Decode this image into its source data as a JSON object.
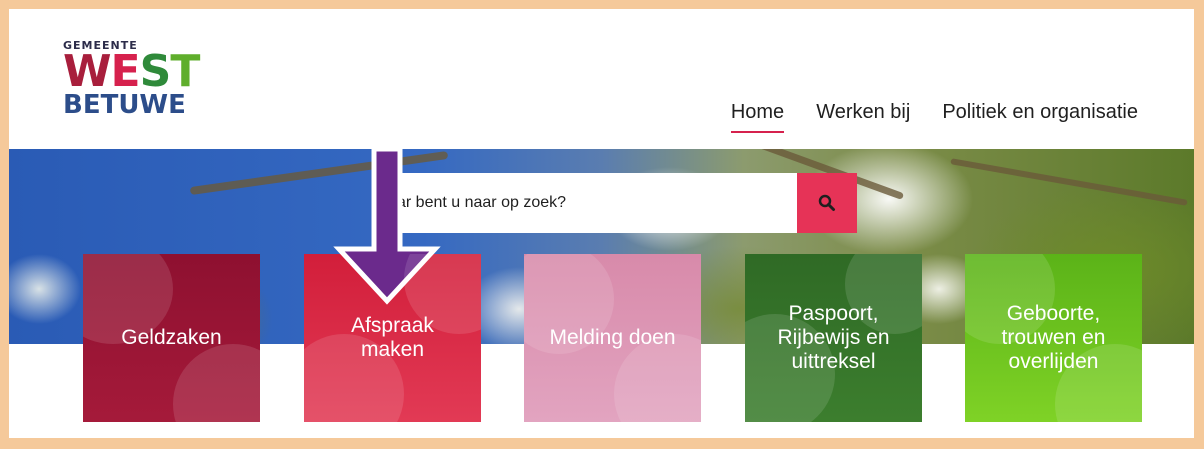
{
  "logo": {
    "top_text": "GEMEENTE",
    "west_letters": [
      "W",
      "E",
      "S",
      "T"
    ],
    "bottom_text": "BETUWE",
    "colors": {
      "w": "#b0203a",
      "e": "#d6214d",
      "s": "#2f8a3a",
      "t": "#5fae2c",
      "betuwe": "#2c4d8a"
    }
  },
  "nav": {
    "items": [
      {
        "label": "Home",
        "active": true
      },
      {
        "label": "Werken bij",
        "active": false
      },
      {
        "label": "Politiek en organisatie",
        "active": false
      }
    ]
  },
  "search": {
    "placeholder": "ar bent u naar op zoek?",
    "button_icon": "search-icon"
  },
  "tiles": [
    {
      "label": "Geldzaken",
      "color": "#9e1636"
    },
    {
      "label": "Afspraak maken",
      "color": "#dc2a46"
    },
    {
      "label": "Melding doen",
      "color": "#dd97b5"
    },
    {
      "label": "Paspoort, Rijbewijs en uittreksel",
      "color": "#357429"
    },
    {
      "label": "Geboorte, trouwen en overlijden",
      "color": "#6cc41f"
    }
  ],
  "annotation": {
    "arrow_color": "#6b2a8c",
    "arrow_icon": "down-arrow-icon"
  },
  "colors": {
    "accent": "#d6214d",
    "frame": "#f5c99a"
  }
}
